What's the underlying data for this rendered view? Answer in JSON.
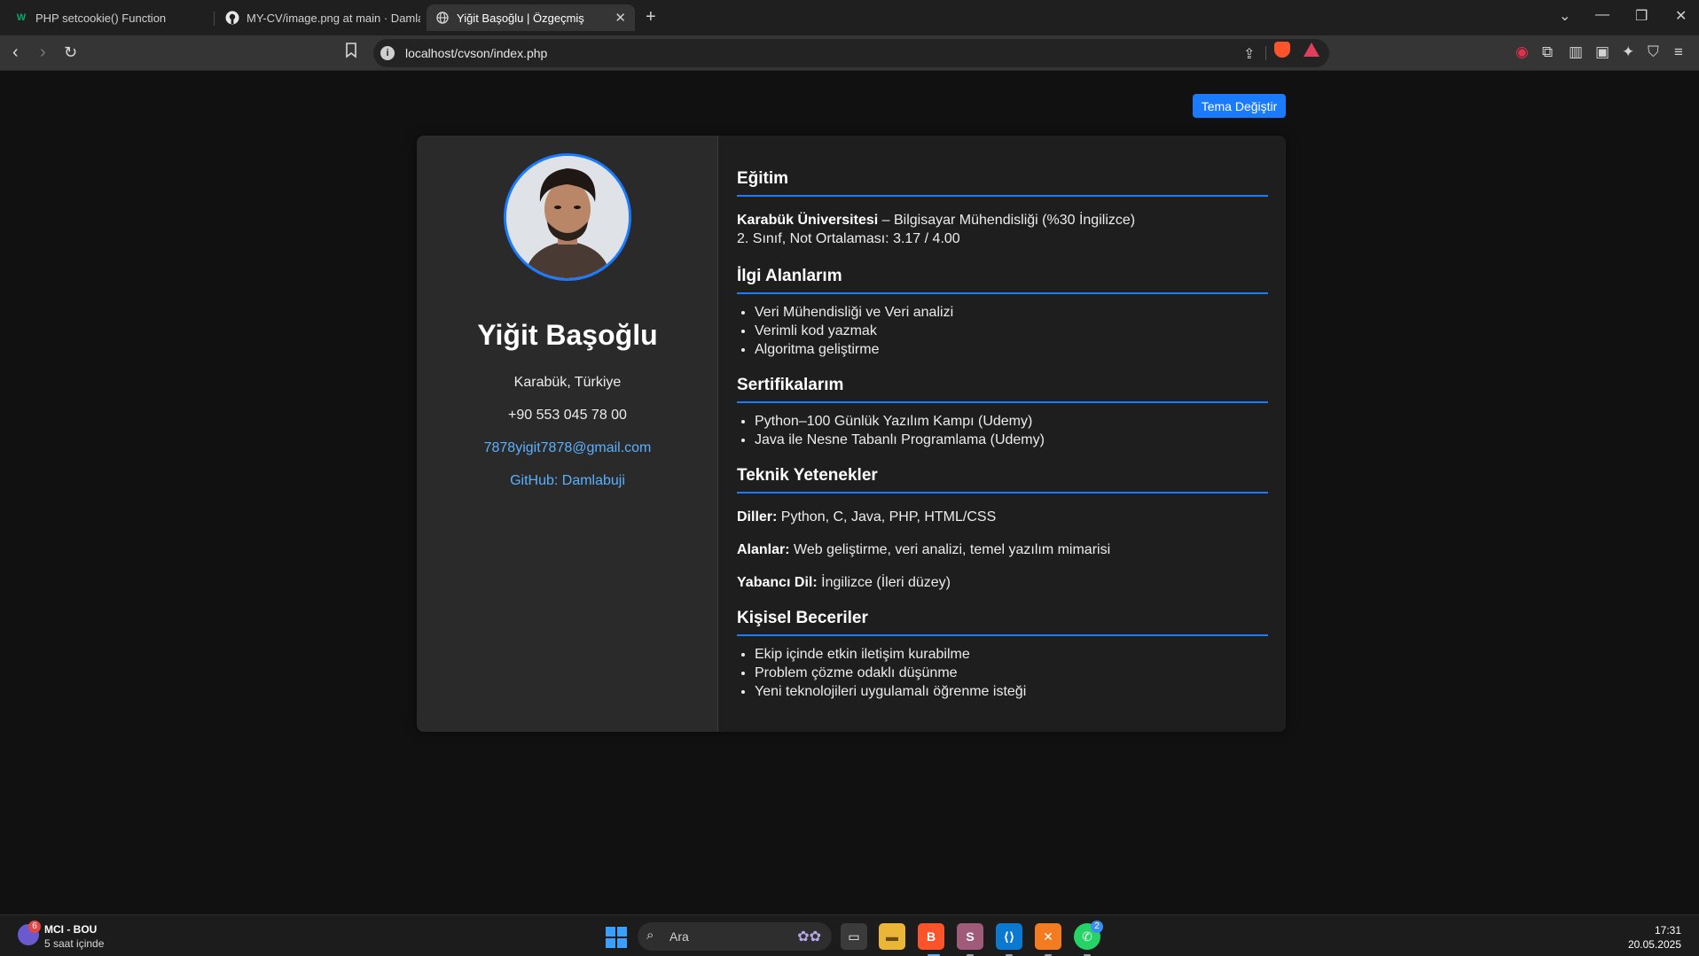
{
  "browser": {
    "tabs": [
      {
        "title": "PHP setcookie() Function",
        "icon": "w3schools-icon"
      },
      {
        "title": "MY-CV/image.png at main · Damlab",
        "icon": "github-icon"
      },
      {
        "title": "Yiğit Başoğlu | Özgeçmiş",
        "icon": "globe-icon",
        "active": true
      }
    ],
    "new_tab": "+",
    "url": "localhost/cvson/index.php"
  },
  "page": {
    "theme_button": "Tema Değiştir",
    "profile": {
      "name": "Yiğit Başoğlu",
      "location": "Karabük, Türkiye",
      "phone": "+90 553 045 78 00",
      "email": "7878yigit7878@gmail.com",
      "github": "GitHub: Damlabuji"
    },
    "education": {
      "title": "Eğitim",
      "school": "Karabük Üniversitesi",
      "program": " – Bilgisayar Mühendisliği (%30 İngilizce)",
      "details": "2. Sınıf, Not Ortalaması: 3.17 / 4.00"
    },
    "interests": {
      "title": "İlgi Alanlarım",
      "items": [
        "Veri Mühendisliği ve Veri analizi",
        "Verimli kod yazmak",
        "Algoritma geliştirme"
      ]
    },
    "certificates": {
      "title": "Sertifikalarım",
      "items": [
        "Python–100 Günlük Yazılım Kampı (Udemy)",
        "Java ile Nesne Tabanlı Programlama (Udemy)"
      ]
    },
    "technical": {
      "title": "Teknik Yetenekler",
      "languages_label": "Diller:",
      "languages": " Python, C, Java, PHP, HTML/CSS",
      "areas_label": "Alanlar:",
      "areas": " Web geliştirme, veri analizi, temel yazılım mimarisi",
      "foreign_label": "Yabancı Dil:",
      "foreign": " İngilizce (İleri düzey)"
    },
    "personal": {
      "title": "Kişisel Beceriler",
      "items": [
        "Ekip içinde etkin iletişim kurabilme",
        "Problem çözme odaklı düşünme",
        "Yeni teknolojileri uygulamalı öğrenme isteği"
      ]
    }
  },
  "taskbar": {
    "weather_badge": "6",
    "weather_title": "MCI - BOU",
    "weather_sub": "5 saat içinde",
    "search_placeholder": "Ara",
    "whatsapp_badge": "2",
    "time": "17:31",
    "date": "20.05.2025"
  },
  "colors": {
    "accent": "#1a7bff",
    "link": "#5ab0ff",
    "page_bg": "#111111",
    "left_panel": "#2a2a2a",
    "right_panel": "#1e1e1e"
  }
}
